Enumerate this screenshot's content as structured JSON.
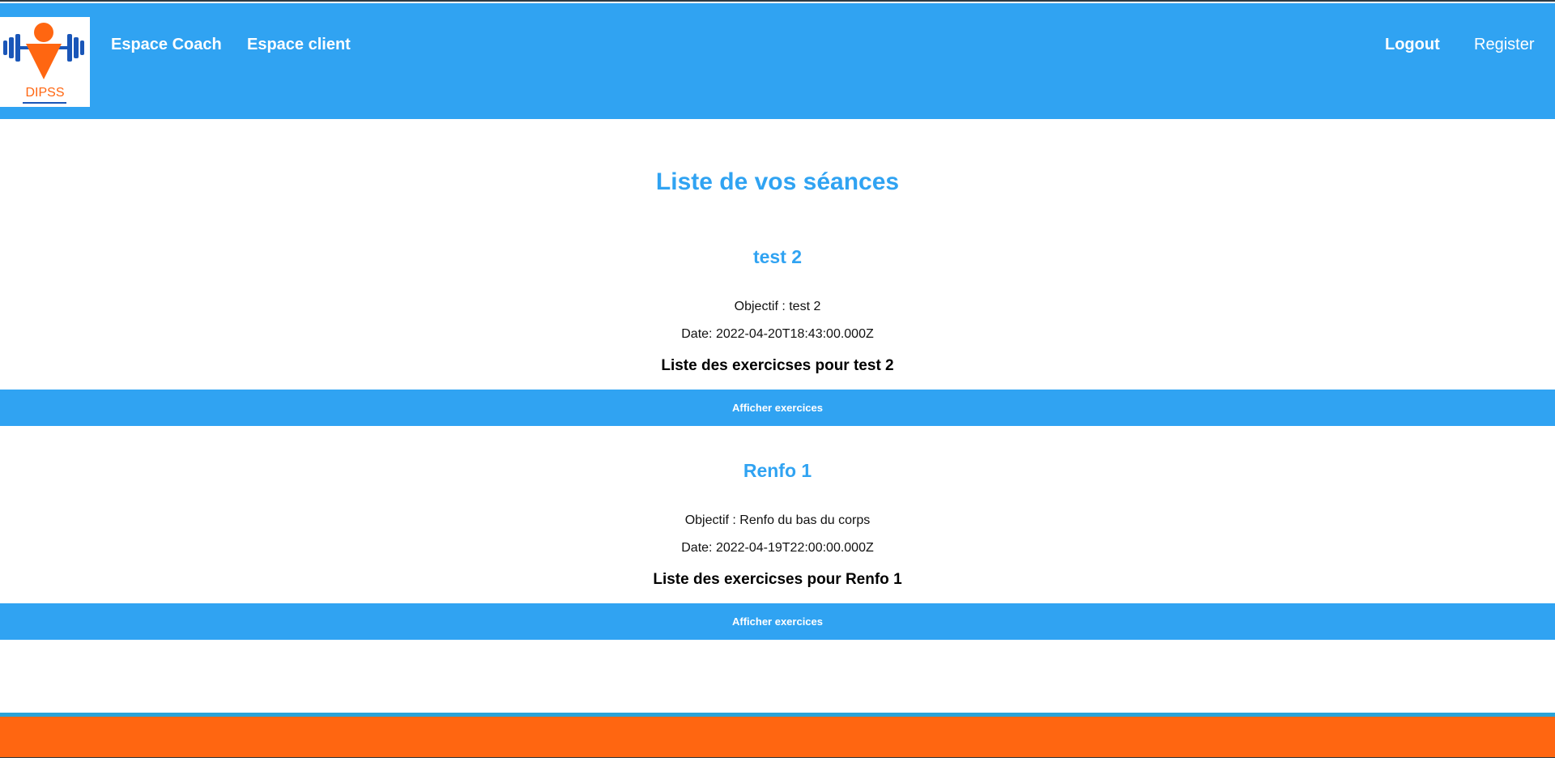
{
  "brand": {
    "logo_icon": "dumbbell-person-logo",
    "logo_text": "DIPSS",
    "colors": {
      "blue": "#30a3f2",
      "orange": "#ff6611",
      "dark_blue": "#1a56b8"
    }
  },
  "nav": {
    "left": [
      {
        "label": "Espace Coach"
      },
      {
        "label": "Espace client"
      }
    ],
    "right": {
      "logout_label": "Logout",
      "register_label": "Register"
    }
  },
  "main": {
    "title": "Liste de vos séances",
    "sessions": [
      {
        "title": "test 2",
        "objectif": "Objectif : test 2",
        "date": "Date: 2022-04-20T18:43:00.000Z",
        "exercises_heading": "Liste des exercicses pour test 2",
        "button_label": "Afficher exercices"
      },
      {
        "title": "Renfo 1",
        "objectif": "Objectif : Renfo du bas du corps",
        "date": "Date: 2022-04-19T22:00:00.000Z",
        "exercises_heading": "Liste des exercicses pour Renfo 1",
        "button_label": "Afficher exercices"
      }
    ]
  }
}
